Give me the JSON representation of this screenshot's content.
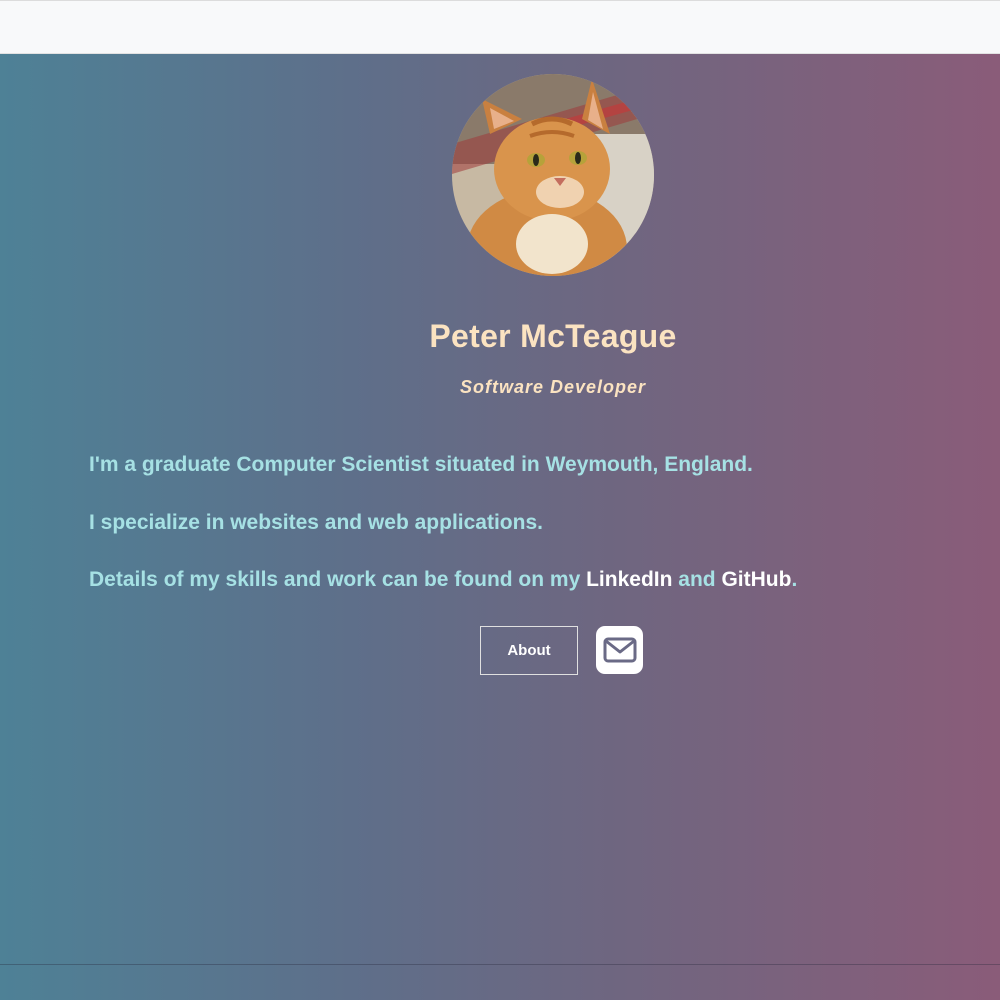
{
  "profile": {
    "name": "Peter McTeague",
    "role": "Software Developer",
    "avatar_icon": "ginger-cat-photo"
  },
  "bio": {
    "line1": "I'm a graduate Computer Scientist situated in Weymouth, England.",
    "line2": "I specialize in websites and web applications.",
    "line3_prefix": "Details of my skills and work can be found on my ",
    "linkedin_label": "LinkedIn",
    "line3_middle": " and ",
    "github_label": "GitHub",
    "line3_suffix": "."
  },
  "actions": {
    "about_label": "About",
    "mail_icon": "envelope-icon"
  },
  "colors": {
    "gradient_left": "#4e8196",
    "gradient_right": "#8a5c79",
    "heading": "#fbe3c1",
    "bio_text": "#a6e1e4",
    "link": "#ffffff"
  }
}
